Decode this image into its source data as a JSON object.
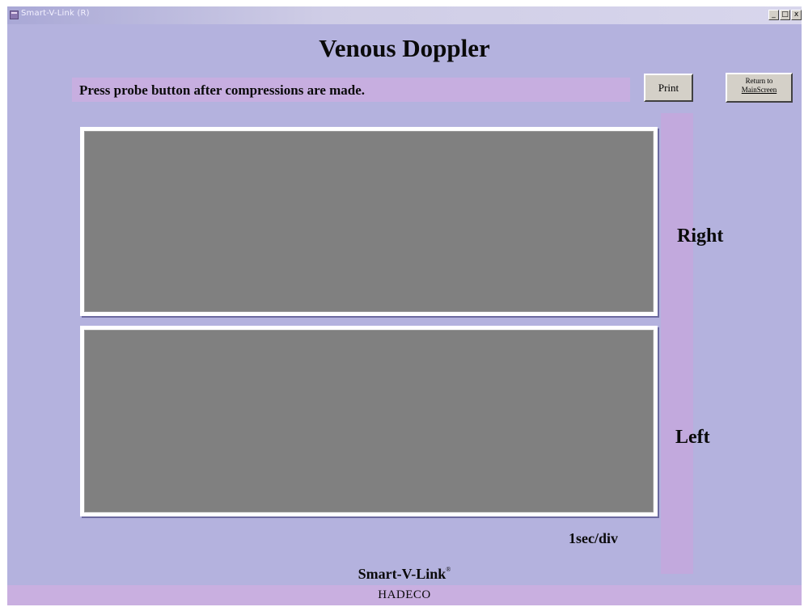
{
  "window": {
    "title": "Smart-V-Link (R)",
    "controls": {
      "minimize": "_",
      "maximize": "□",
      "close": "x"
    }
  },
  "page": {
    "title": "Venous Doppler",
    "instruction": "Press probe button after compressions are made."
  },
  "toolbar": {
    "print_label": "Print",
    "return_line1": "Return to",
    "return_line2": "MainScreen"
  },
  "graphs": {
    "right_label": "Right",
    "left_label": "Left",
    "timescale": "1sec/div"
  },
  "footer": {
    "brand": "Smart-V-Link",
    "brand_mark": "®",
    "company": "HADECO"
  },
  "colors": {
    "background": "#b4b2de",
    "accent_panel": "#c7aee0",
    "graph_fill": "#808080",
    "graph_border": "#ffffff"
  }
}
